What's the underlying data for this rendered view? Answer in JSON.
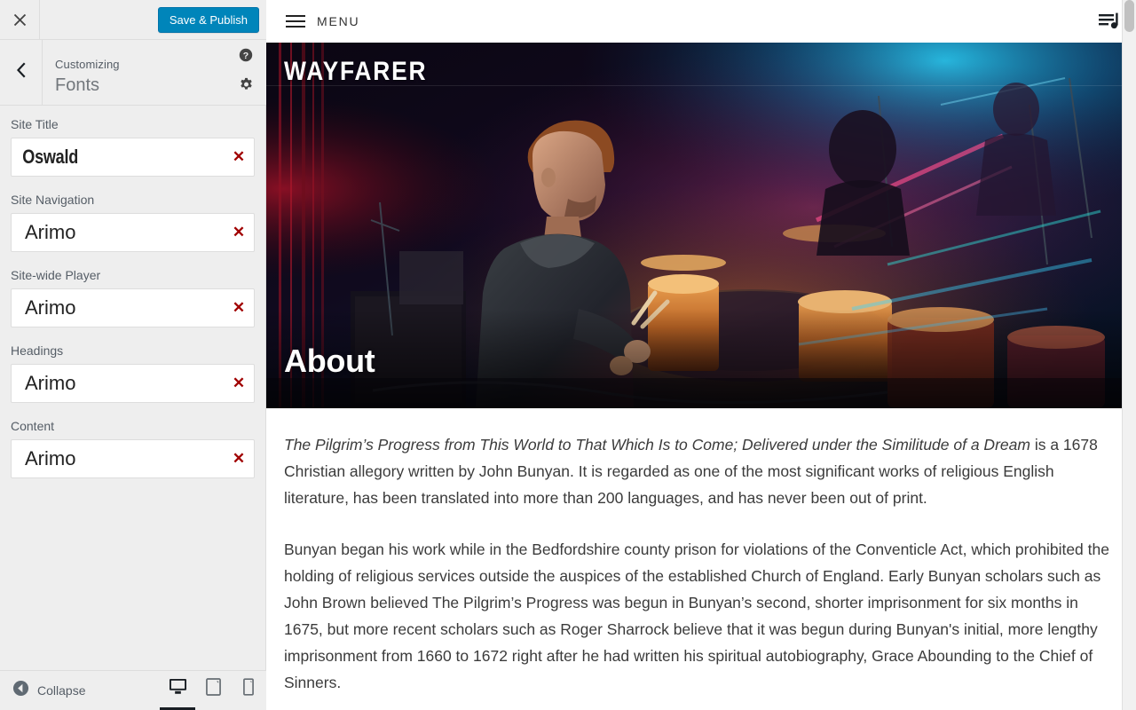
{
  "customizer": {
    "close_icon": "close-icon",
    "save_label": "Save & Publish",
    "back_icon": "chevron-left-icon",
    "breadcrumb_label": "Customizing",
    "section_title": "Fonts",
    "help_icon": "help-circle-icon",
    "gear_icon": "gear-icon",
    "accent_color": "#0085ba",
    "clear_glyph": "✕",
    "controls": [
      {
        "label": "Site Title",
        "value": "Oswald",
        "clear_name": "clear-site-title"
      },
      {
        "label": "Site Navigation",
        "value": "Arimo",
        "clear_name": "clear-site-navigation"
      },
      {
        "label": "Site-wide Player",
        "value": "Arimo",
        "clear_name": "clear-site-wide-player"
      },
      {
        "label": "Headings",
        "value": "Arimo",
        "clear_name": "clear-headings"
      },
      {
        "label": "Content",
        "value": "Arimo",
        "clear_name": "clear-content"
      }
    ],
    "footer": {
      "collapse_label": "Collapse",
      "collapse_icon": "collapse-arrow-icon",
      "devices": [
        {
          "name": "desktop",
          "icon": "desktop-icon",
          "active": true
        },
        {
          "name": "tablet",
          "icon": "tablet-icon",
          "active": false
        },
        {
          "name": "mobile",
          "icon": "mobile-icon",
          "active": false
        }
      ]
    }
  },
  "preview": {
    "nav": {
      "menu_label": "MENU",
      "menu_icon": "hamburger-icon",
      "playlist_icon": "playlist-music-icon"
    },
    "hero": {
      "site_title": "WAYFARER",
      "page_title": "About",
      "image_alt": "drummer-performing-on-stage"
    },
    "paragraphs": [
      {
        "italic_lead": "The Pilgrim’s Progress from This World to That Which Is to Come; Delivered under the Similitude of a Dream",
        "rest": " is a 1678 Christian allegory written by John Bunyan. It is regarded as one of the most significant works of religious English literature, has been translated into more than 200 languages, and has never been out of print."
      },
      {
        "italic_lead": "",
        "rest": "Bunyan began his work while in the Bedfordshire county prison for violations of the Conventicle Act, which prohibited the holding of religious services outside the auspices of the established Church of England. Early Bunyan scholars such as John Brown believed The Pilgrim’s Progress was begun in Bunyan’s second, shorter imprisonment for six months in 1675, but more recent scholars such as Roger Sharrock believe that it was begun during Bunyan's initial, more lengthy imprisonment from 1660 to 1672 right after he had written his spiritual autobiography, Grace Abounding to the Chief of Sinners."
      }
    ]
  }
}
